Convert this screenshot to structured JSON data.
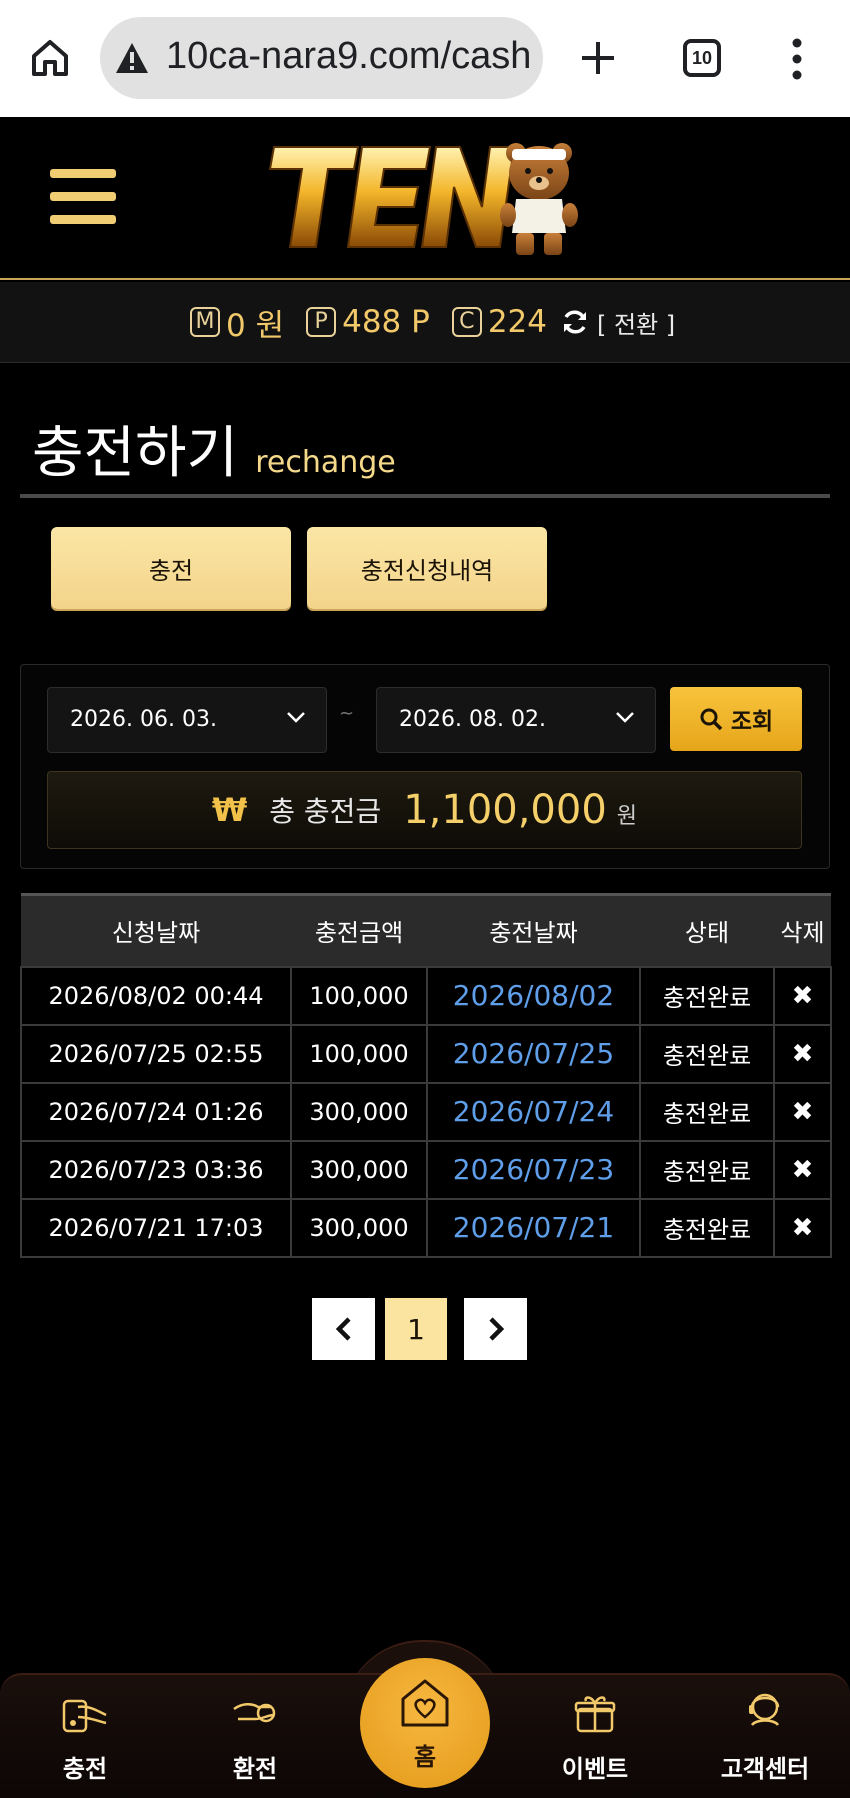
{
  "browser": {
    "url": "10ca-nara9.com/cash",
    "tab_count": "10"
  },
  "balance": {
    "money_badge": "M",
    "money_value": "0 원",
    "point_badge": "P",
    "point_value": "488 P",
    "comp_badge": "C",
    "comp_value": "224",
    "switch_label": "[ 전환 ]"
  },
  "page": {
    "title_ko": "충전하기",
    "title_en": "rechange"
  },
  "tabs": {
    "charge_label": "충전",
    "history_label": "충전신청내역"
  },
  "filter": {
    "date_from": "2026. 06. 03.",
    "separator": "~",
    "date_to": "2026. 08. 02.",
    "search_label": "조회",
    "total_icon": "₩",
    "total_label": "총 충전금",
    "total_value": "1,100,000",
    "total_unit": "원"
  },
  "table": {
    "headers": [
      "신청날짜",
      "충전금액",
      "충전날짜",
      "상태",
      "삭제"
    ],
    "rows": [
      {
        "request_date": "2026/08/02 00:44",
        "amount": "100,000",
        "charge_date": "2026/08/02",
        "status": "충전완료",
        "delete": "✖"
      },
      {
        "request_date": "2026/07/25 02:55",
        "amount": "100,000",
        "charge_date": "2026/07/25",
        "status": "충전완료",
        "delete": "✖"
      },
      {
        "request_date": "2026/07/24 01:26",
        "amount": "300,000",
        "charge_date": "2026/07/24",
        "status": "충전완료",
        "delete": "✖"
      },
      {
        "request_date": "2026/07/23 03:36",
        "amount": "300,000",
        "charge_date": "2026/07/23",
        "status": "충전완료",
        "delete": "✖"
      },
      {
        "request_date": "2026/07/21 17:03",
        "amount": "300,000",
        "charge_date": "2026/07/21",
        "status": "충전완료",
        "delete": "✖"
      }
    ]
  },
  "pagination": {
    "current": "1"
  },
  "bottom_nav": {
    "deposit": "충전",
    "withdraw": "환전",
    "home": "홈",
    "event": "이벤트",
    "support": "고객센터"
  },
  "colors": {
    "accent_gold": "#f2c96a",
    "button_gold": "#f3d48a",
    "link_blue": "#5f9ee8"
  }
}
